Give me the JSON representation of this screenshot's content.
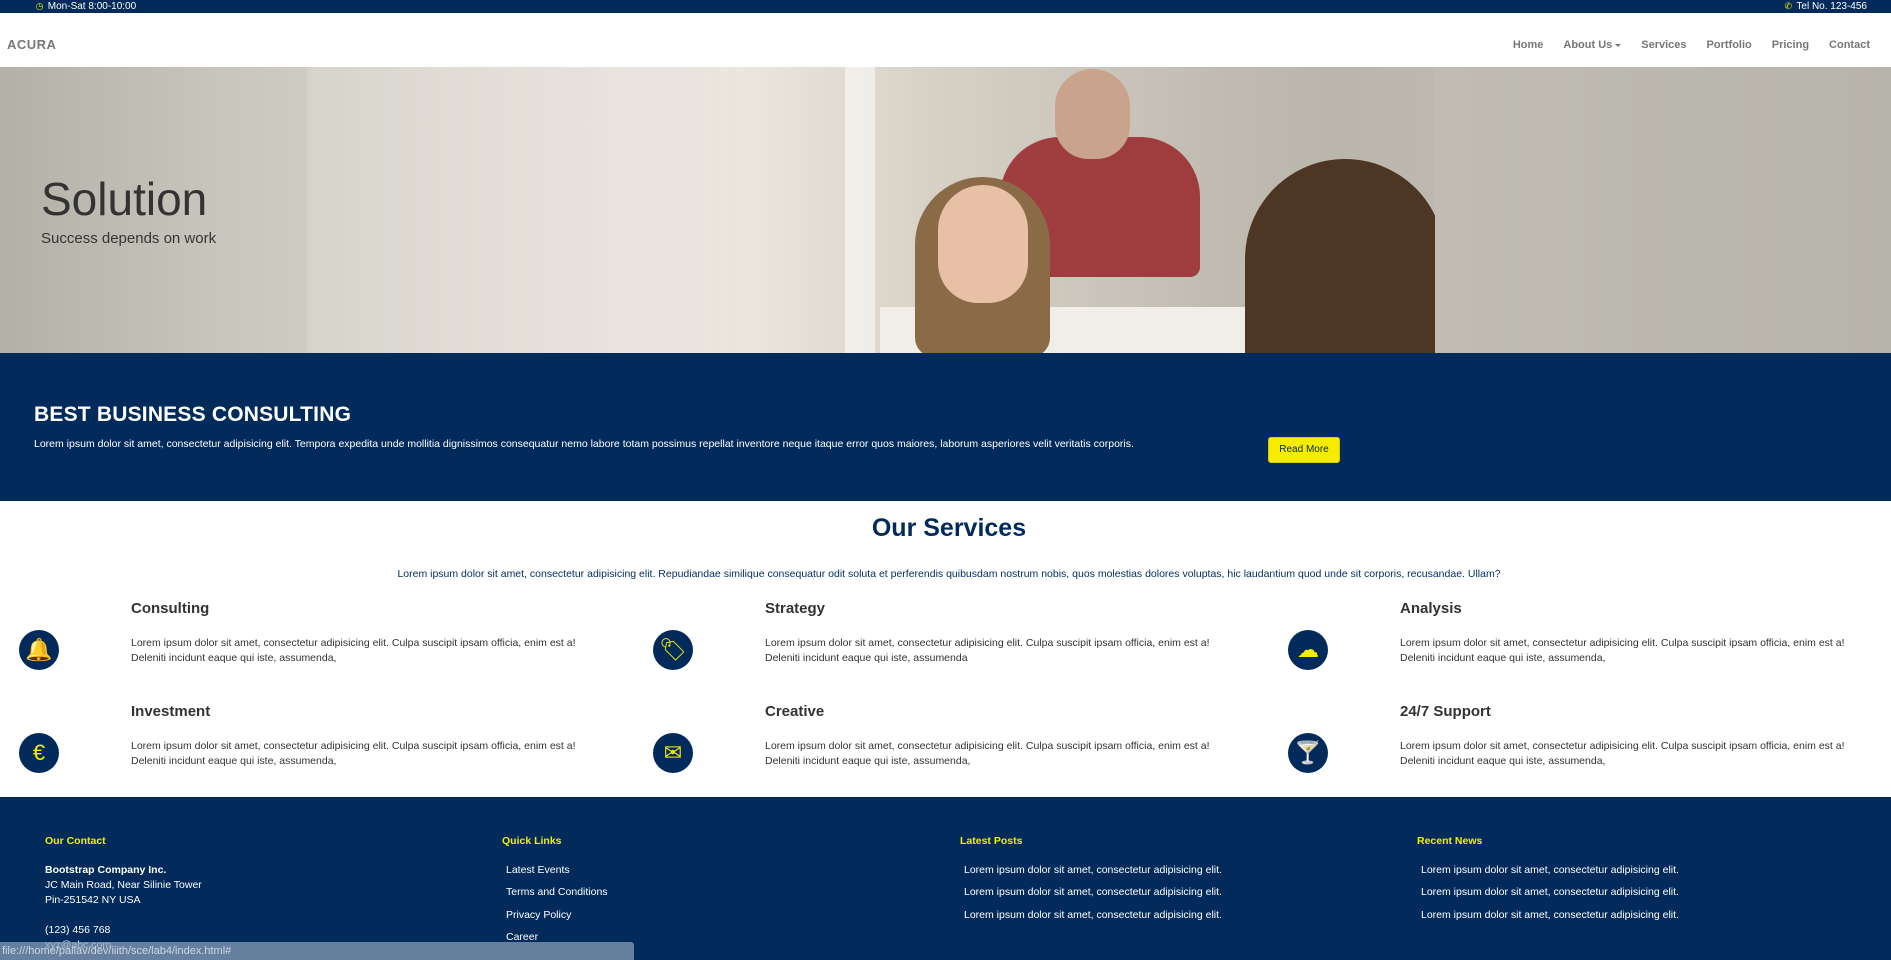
{
  "topbar": {
    "hours": "Mon-Sat 8:00-10:00",
    "phone": "Tel No. 123-456",
    "hours_icon": "clock-icon",
    "phone_icon": "phone-icon"
  },
  "navbar": {
    "brand": "ACURA",
    "items": [
      {
        "label": "Home"
      },
      {
        "label": "About Us"
      },
      {
        "label": "Services"
      },
      {
        "label": "Portfolio"
      },
      {
        "label": "Pricing"
      },
      {
        "label": "Contact"
      }
    ]
  },
  "hero": {
    "title": "Solution",
    "subtitle": "Success depends on work"
  },
  "banner": {
    "title": "BEST BUSINESS CONSULTING",
    "text": "Lorem ipsum dolor sit amet, consectetur adipisicing elit. Tempora expedita unde mollitia dignissimos consequatur nemo labore totam possimus repellat inventore neque itaque error quos maiores, laborum asperiores velit veritatis corporis.",
    "button": "Read More"
  },
  "services": {
    "title": "Our Services",
    "intro": "Lorem ipsum dolor sit amet, consectetur adipisicing elit. Repudiandae similique consequatur odit soluta et perferendis quibusdam nostrum nobis, quos molestias dolores voluptas, hic laudantium quod unde sit corporis, recusandae. Ullam?",
    "items": [
      {
        "title": "Consulting",
        "desc": "Lorem ipsum dolor sit amet, consectetur adipisicing elit. Culpa suscipit ipsam officia, enim est a! Deleniti incidunt eaque qui iste, assumenda,",
        "icon": "bell-icon",
        "glyph": "🔔"
      },
      {
        "title": "Strategy",
        "desc": "Lorem ipsum dolor sit amet, consectetur adipisicing elit. Culpa suscipit ipsam officia, enim est a! Deleniti incidunt eaque qui iste, assumenda",
        "icon": "tag-icon",
        "glyph": "🏷"
      },
      {
        "title": "Analysis",
        "desc": "Lorem ipsum dolor sit amet, consectetur adipisicing elit. Culpa suscipit ipsam officia, enim est a! Deleniti incidunt eaque qui iste, assumenda,",
        "icon": "cloud-icon",
        "glyph": "☁"
      },
      {
        "title": "Investment",
        "desc": "Lorem ipsum dolor sit amet, consectetur adipisicing elit. Culpa suscipit ipsam officia, enim est a! Deleniti incidunt eaque qui iste, assumenda,",
        "icon": "euro-icon",
        "glyph": "€"
      },
      {
        "title": "Creative",
        "desc": "Lorem ipsum dolor sit amet, consectetur adipisicing elit. Culpa suscipit ipsam officia, enim est a! Deleniti incidunt eaque qui iste, assumenda,",
        "icon": "envelope-icon",
        "glyph": "✉"
      },
      {
        "title": "24/7 Support",
        "desc": "Lorem ipsum dolor sit amet, consectetur adipisicing elit. Culpa suscipit ipsam officia, enim est a! Deleniti incidunt eaque qui iste, assumenda,",
        "icon": "glass-icon",
        "glyph": "🍸"
      }
    ]
  },
  "footer": {
    "contact": {
      "heading": "Our Contact",
      "company": "Bootstrap Company Inc.",
      "address1": "JC Main Road, Near Silinie Tower",
      "address2": "Pin-251542 NY USA",
      "phone": "(123) 456 768",
      "email": "xyz@abc.com"
    },
    "quick_links": {
      "heading": "Quick Links",
      "items": [
        "Latest Events",
        "Terms and Conditions",
        "Privacy Policy",
        "Career"
      ]
    },
    "latest_posts": {
      "heading": "Latest Posts",
      "items": [
        "Lorem ipsum dolor sit amet, consectetur adipisicing elit.",
        "Lorem ipsum dolor sit amet, consectetur adipisicing elit.",
        "Lorem ipsum dolor sit amet, consectetur adipisicing elit."
      ]
    },
    "recent_news": {
      "heading": "Recent News",
      "items": [
        "Lorem ipsum dolor sit amet, consectetur adipisicing elit.",
        "Lorem ipsum dolor sit amet, consectetur adipisicing elit.",
        "Lorem ipsum dolor sit amet, consectetur adipisicing elit."
      ]
    }
  },
  "status_bar": {
    "url": "file:///home/pallav/dev/iiith/sce/lab4/index.html#"
  },
  "colors": {
    "primary": "#022b5c",
    "accent": "#f5ec00",
    "text": "#333333",
    "nav_text": "#777777"
  }
}
